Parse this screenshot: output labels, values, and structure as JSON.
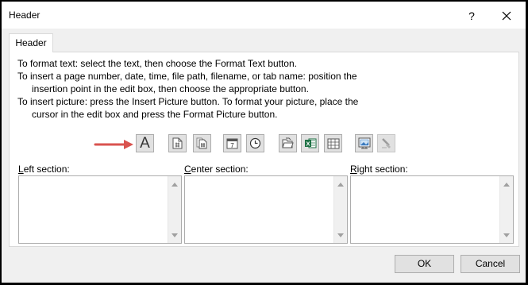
{
  "window": {
    "title": "Header",
    "help_label": "?"
  },
  "tabs": [
    {
      "label": "Header"
    }
  ],
  "instructions": [
    "To format text:  select the text, then choose the Format Text button.",
    "To insert a page number, date, time, file path, filename, or tab name:  position the",
    "insertion point in the edit box, then choose the appropriate button.",
    "To insert picture: press the Insert Picture button.  To format your picture, place the",
    "cursor in the edit box and press the Format Picture button."
  ],
  "toolbar": {
    "format_text_label": "A",
    "buttons": [
      {
        "name": "format-text-button",
        "icon": "format-text-icon"
      },
      {
        "name": "insert-page-number-button",
        "icon": "page-number-icon"
      },
      {
        "name": "insert-number-of-pages-button",
        "icon": "number-of-pages-icon"
      },
      {
        "name": "insert-date-button",
        "icon": "calendar-icon"
      },
      {
        "name": "insert-time-button",
        "icon": "clock-icon"
      },
      {
        "name": "insert-file-path-button",
        "icon": "folder-icon"
      },
      {
        "name": "insert-file-name-button",
        "icon": "excel-file-icon"
      },
      {
        "name": "insert-sheet-name-button",
        "icon": "sheet-icon"
      },
      {
        "name": "insert-picture-button",
        "icon": "picture-icon"
      },
      {
        "name": "format-picture-button",
        "icon": "format-picture-icon",
        "enabled": false
      }
    ],
    "accent_arrow_color": "#d9534f"
  },
  "sections": {
    "left": {
      "label_key": "L",
      "label_rest": "eft section:",
      "value": ""
    },
    "center": {
      "label_key": "C",
      "label_rest": "enter section:",
      "value": ""
    },
    "right": {
      "label_key": "R",
      "label_rest": "ight section:",
      "value": ""
    }
  },
  "buttons": {
    "ok": "OK",
    "cancel": "Cancel"
  }
}
